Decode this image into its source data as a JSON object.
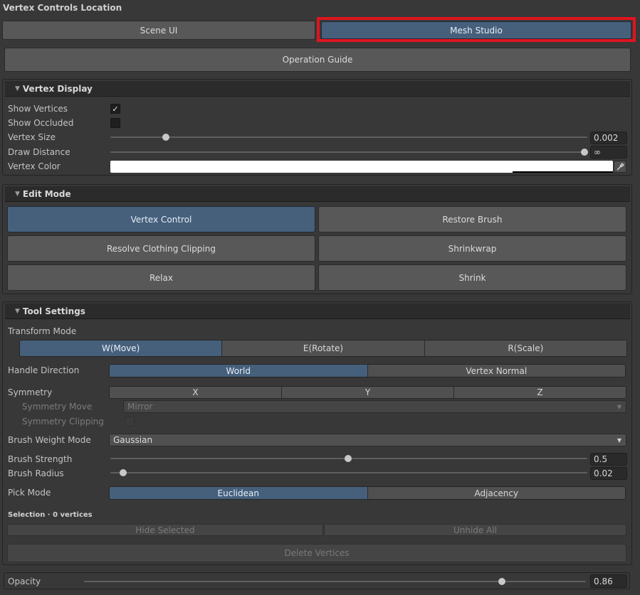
{
  "location": {
    "title": "Vertex Controls Location",
    "options": [
      "Scene UI",
      "Mesh Studio"
    ],
    "selected": "Mesh Studio"
  },
  "operation_guide_label": "Operation Guide",
  "vertex_display": {
    "header": "Vertex Display",
    "show_vertices_label": "Show Vertices",
    "show_vertices": true,
    "show_occluded_label": "Show Occluded",
    "show_occluded": false,
    "vertex_size_label": "Vertex Size",
    "vertex_size": "0.002",
    "draw_distance_label": "Draw Distance",
    "draw_distance": "∞",
    "vertex_color_label": "Vertex Color",
    "vertex_color": "#ffffff",
    "eyedropper_icon": "eyedropper-icon"
  },
  "edit_mode": {
    "header": "Edit Mode",
    "buttons": [
      "Vertex Control",
      "Restore Brush",
      "Resolve Clothing Clipping",
      "Shrinkwrap",
      "Relax",
      "Shrink"
    ],
    "selected": "Vertex Control"
  },
  "tool_settings": {
    "header": "Tool Settings",
    "transform_mode_label": "Transform Mode",
    "transform_modes": [
      "W(Move)",
      "E(Rotate)",
      "R(Scale)"
    ],
    "transform_selected": "W(Move)",
    "handle_direction_label": "Handle Direction",
    "handle_directions": [
      "World",
      "Vertex Normal"
    ],
    "handle_selected": "World",
    "symmetry_label": "Symmetry",
    "symmetry_axes": [
      "X",
      "Y",
      "Z"
    ],
    "symmetry_move_label": "Symmetry Move",
    "symmetry_move_value": "Mirror",
    "symmetry_clipping_label": "Symmetry Clipping",
    "symmetry_clipping": false,
    "brush_weight_mode_label": "Brush Weight Mode",
    "brush_weight_mode": "Gaussian",
    "brush_strength_label": "Brush Strength",
    "brush_strength": "0.5",
    "brush_radius_label": "Brush Radius",
    "brush_radius": "0.02",
    "pick_mode_label": "Pick Mode",
    "pick_modes": [
      "Euclidean",
      "Adjacency"
    ],
    "pick_selected": "Euclidean",
    "selection_label": "Selection · 0 vertices",
    "hide_selected_label": "Hide Selected",
    "unhide_all_label": "Unhide All",
    "delete_vertices_label": "Delete Vertices"
  },
  "opacity": {
    "label": "Opacity",
    "value": "0.86"
  },
  "colors": {
    "background": "#383838",
    "selected": "#46607c",
    "highlight_outline": "#e0141e"
  }
}
